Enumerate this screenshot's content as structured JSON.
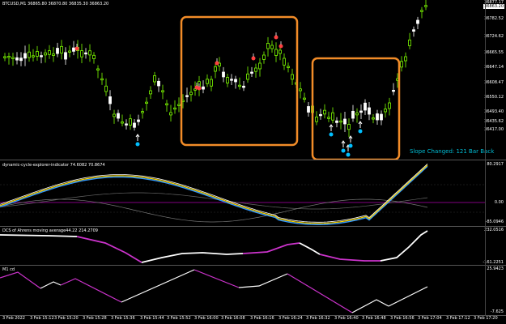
{
  "main_chart": {
    "header": "BTCUSD,M1  36865.80 36870.80 36835.30 36863.20",
    "price_labels": [
      "36877.17",
      "36863.20",
      "36782.52",
      "36724.62",
      "36665.55",
      "36647.14",
      "36608.47",
      "36550.12",
      "36493.40",
      "36435.62",
      "36417.00"
    ],
    "current_price": "36863.20",
    "status_text": "Slope Changed: 121 Bar Back"
  },
  "indicator_1": {
    "header": "dynamic-cycle-explorer-indicator 74.6082 70.8674",
    "levels": [
      "80.2917",
      "0.00",
      "-85.0946"
    ]
  },
  "indicator_2": {
    "header": "DCS of Ahrens moving average44.22 214.2709",
    "levels": [
      "232.0516",
      "-161.2251"
    ]
  },
  "indicator_3": {
    "header": "M1 cd",
    "levels": [
      "25.9423",
      "-7.625"
    ]
  },
  "time_axis": [
    "3 Feb 2022",
    "3 Feb 15:12",
    "3 Feb 15:20",
    "3 Feb 15:28",
    "3 Feb 15:36",
    "3 Feb 15:44",
    "3 Feb 15:52",
    "3 Feb 16:00",
    "3 Feb 16:08",
    "3 Feb 16:16",
    "3 Feb 16:24",
    "3 Feb 16:32",
    "3 Feb 16:40",
    "3 Feb 16:48",
    "3 Feb 16:56",
    "3 Feb 17:04",
    "3 Feb 17:12",
    "3 Feb 17:20"
  ],
  "colors": {
    "bull_candle": "#7fff00",
    "bear_candle": "#ffffff",
    "highlight_box": "#f28c28",
    "sell_arrow": "#ff4040",
    "buy_arrow": "#00bfff",
    "dcs_up": "#ffffff",
    "dcs_down": "#cc33cc",
    "cycle_fast": "#ffd700",
    "cycle_slow": "#3399ff",
    "zero_line": "#800080"
  }
}
